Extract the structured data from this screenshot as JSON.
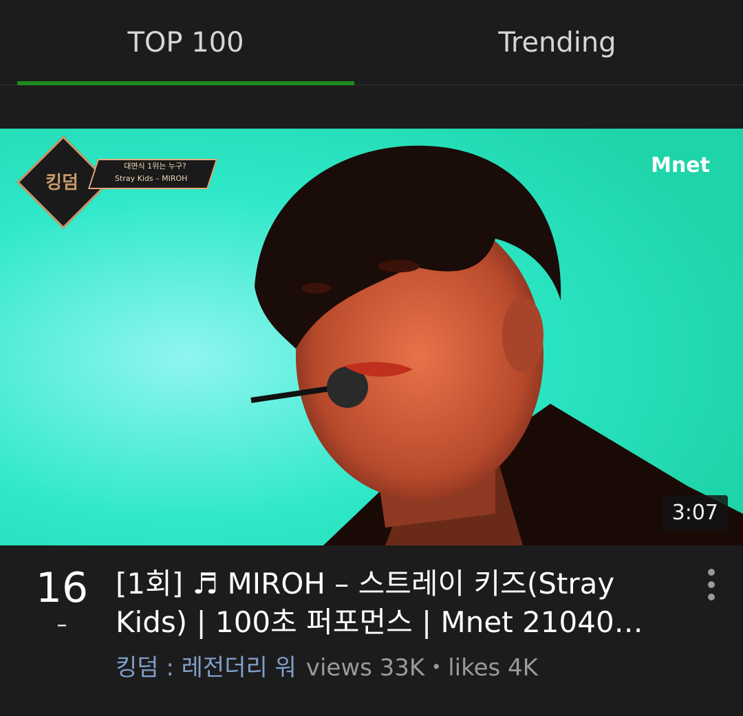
{
  "tabs": [
    {
      "label": "TOP 100",
      "active": true
    },
    {
      "label": "Trending",
      "active": false
    }
  ],
  "colors": {
    "background": "#1c1c1c",
    "active_tab_indicator": "#1e8a1e",
    "channel_link": "#7f9fc9",
    "meta_text": "#9a9a9a"
  },
  "video": {
    "duration": "3:07",
    "thumbnail_overlay": {
      "show_logo": "킹덤",
      "badge_line1": "대면식 1위는 누구?",
      "badge_line2": "Stray Kids – MIROH",
      "network_logo": "Mnet"
    },
    "rank": "16",
    "rank_change": "–",
    "title": "[1회] ♬ MIROH – 스트레이 키즈(Stray Kids) | 100초 퍼포먼스 | Mnet 21040…",
    "channel": "킹덤 : 레전더리 워",
    "stats": "views 33K・likes 4K"
  }
}
